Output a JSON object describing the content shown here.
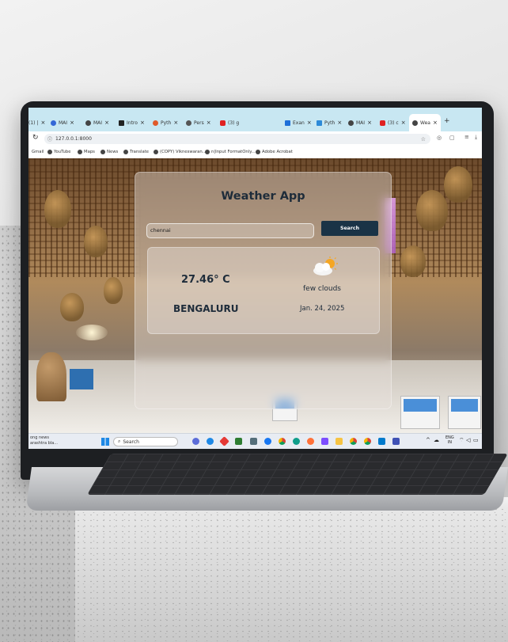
{
  "browser": {
    "tabs": [
      {
        "label": "(1) |",
        "color": "#ffffff"
      },
      {
        "label": "MAI",
        "color": "#3367d6"
      },
      {
        "label": "MAI",
        "color": "#444444"
      },
      {
        "label": "Intro",
        "color": "#222222"
      },
      {
        "label": "Pyth",
        "color": "#e05a2b"
      },
      {
        "label": "Pers",
        "color": "#555555"
      },
      {
        "label": "(3) g",
        "color": "#e02020"
      },
      {
        "label": "Exan",
        "color": "#1e6fd8"
      },
      {
        "label": "Pyth",
        "color": "#2d8ad8"
      },
      {
        "label": "MAI",
        "color": "#444444"
      },
      {
        "label": "(3) c",
        "color": "#e02020"
      },
      {
        "label": "Wea",
        "color": "#444444"
      }
    ],
    "new_tab": "+",
    "url": "127.0.0.1:8000",
    "bookmarks": [
      "Gmail",
      "YouTube",
      "Maps",
      "News",
      "Translate",
      "(COPY) Vikneswaran...",
      "n|Input FormatOnly...",
      "Adobe Acrobat"
    ]
  },
  "weather_app": {
    "title": "Weather App",
    "search_value": "chennai",
    "search_button": "Search",
    "temperature": "27.46° C",
    "city": "BENGALURU",
    "description": "few clouds",
    "date": "Jan. 24, 2025",
    "icon": "few-clouds-icon"
  },
  "taskbar": {
    "news_line1": "ong news",
    "news_line2": "arashtra bla...",
    "search_label": "Search",
    "lang_line1": "ENG",
    "lang_line2": "IN"
  }
}
